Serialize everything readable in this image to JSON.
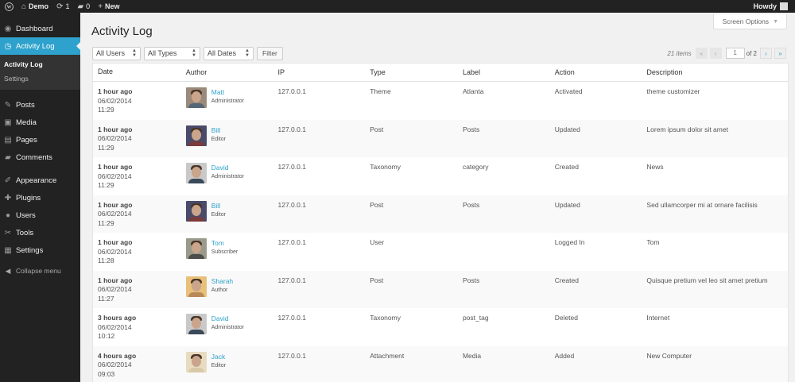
{
  "adminbar": {
    "site_name": "Demo",
    "updates": "1",
    "comments": "0",
    "new_label": "New",
    "howdy": "Howdy"
  },
  "sidebar": {
    "items": [
      {
        "label": "Dashboard",
        "icon": "dashboard-icon",
        "glyph": "◉"
      },
      {
        "label": "Activity Log",
        "icon": "clock-icon",
        "glyph": "◷"
      },
      {
        "label": "Posts",
        "icon": "pin-icon",
        "glyph": "✎"
      },
      {
        "label": "Media",
        "icon": "media-icon",
        "glyph": "▣"
      },
      {
        "label": "Pages",
        "icon": "pages-icon",
        "glyph": "▤"
      },
      {
        "label": "Comments",
        "icon": "comment-icon",
        "glyph": "▰"
      },
      {
        "label": "Appearance",
        "icon": "brush-icon",
        "glyph": "✐"
      },
      {
        "label": "Plugins",
        "icon": "plug-icon",
        "glyph": "✚"
      },
      {
        "label": "Users",
        "icon": "user-icon",
        "glyph": "●"
      },
      {
        "label": "Tools",
        "icon": "wrench-icon",
        "glyph": "✂"
      },
      {
        "label": "Settings",
        "icon": "settings-icon",
        "glyph": "▦"
      }
    ],
    "submenu": [
      "Activity Log",
      "Settings"
    ],
    "collapse": "Collapse menu"
  },
  "screen_options": "Screen Options",
  "page_title": "Activity Log",
  "filters": {
    "users": "All Users",
    "types": "All Types",
    "dates": "All Dates",
    "filter_button": "Filter"
  },
  "pagination": {
    "items": "21 items",
    "first": "«",
    "prev": "‹",
    "current": "1",
    "total": "of 2",
    "next": "›",
    "last": "»"
  },
  "table": {
    "headers": {
      "date": "Date",
      "author": "Author",
      "ip": "IP",
      "type": "Type",
      "label": "Label",
      "action": "Action",
      "description": "Description"
    },
    "rows": [
      {
        "rel": "1 hour ago",
        "date": "06/02/2014",
        "time": "11:29",
        "name": "Matt",
        "role": "Administrator",
        "ip": "127.0.0.1",
        "type": "Theme",
        "label": "Atlanta",
        "action": "Activated",
        "description": "theme customizer"
      },
      {
        "rel": "1 hour ago",
        "date": "06/02/2014",
        "time": "11:29",
        "name": "Bill",
        "role": "Editor",
        "ip": "127.0.0.1",
        "type": "Post",
        "label": "Posts",
        "action": "Updated",
        "description": "Lorem ipsum dolor sit amet"
      },
      {
        "rel": "1 hour ago",
        "date": "06/02/2014",
        "time": "11:29",
        "name": "David",
        "role": "Administrator",
        "ip": "127.0.0.1",
        "type": "Taxonomy",
        "label": "category",
        "action": "Created",
        "description": "News"
      },
      {
        "rel": "1 hour ago",
        "date": "06/02/2014",
        "time": "11:29",
        "name": "Bill",
        "role": "Editor",
        "ip": "127.0.0.1",
        "type": "Post",
        "label": "Posts",
        "action": "Updated",
        "description": "Sed ullamcorper mi at ornare facilisis"
      },
      {
        "rel": "1 hour ago",
        "date": "06/02/2014",
        "time": "11:28",
        "name": "Tom",
        "role": "Subscriber",
        "ip": "127.0.0.1",
        "type": "User",
        "label": "",
        "action": "Logged In",
        "description": "Tom"
      },
      {
        "rel": "1 hour ago",
        "date": "06/02/2014",
        "time": "11:27",
        "name": "Sharah",
        "role": "Author",
        "ip": "127.0.0.1",
        "type": "Post",
        "label": "Posts",
        "action": "Created",
        "description": "Quisque pretium vel leo sit amet pretium"
      },
      {
        "rel": "3 hours ago",
        "date": "06/02/2014",
        "time": "10:12",
        "name": "David",
        "role": "Administrator",
        "ip": "127.0.0.1",
        "type": "Taxonomy",
        "label": "post_tag",
        "action": "Deleted",
        "description": "Internet"
      },
      {
        "rel": "4 hours ago",
        "date": "06/02/2014",
        "time": "09:03",
        "name": "Jack",
        "role": "Editor",
        "ip": "127.0.0.1",
        "type": "Attachment",
        "label": "Media",
        "action": "Added",
        "description": "New Computer"
      }
    ]
  },
  "colors": {
    "accent": "#2ea2cc",
    "sidebar_bg": "#222222",
    "avatar_shirts": [
      "#556677",
      "#7a3b3b",
      "#3b4a5a",
      "#7a3b3b",
      "#4d4d4d",
      "#b88a5a",
      "#3b4a5a",
      "#d8c9a8"
    ],
    "avatar_bgs": [
      "#9b8a7a",
      "#4a4a6a",
      "#c9c9c9",
      "#4a4a6a",
      "#9a9a8a",
      "#e8c07a",
      "#c9c9c9",
      "#e8dcc0"
    ]
  }
}
